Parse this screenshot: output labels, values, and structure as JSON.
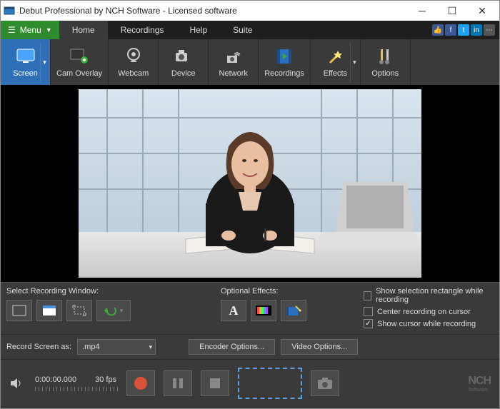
{
  "title": "Debut Professional by NCH Software - Licensed software",
  "menu_btn": "Menu",
  "tabs": [
    "Home",
    "Recordings",
    "Help",
    "Suite"
  ],
  "active_tab": 0,
  "tools": [
    {
      "label": "Screen",
      "icon": "screen",
      "dropdown": true,
      "selected": true
    },
    {
      "label": "Cam Overlay",
      "icon": "camoverlay"
    },
    {
      "label": "Webcam",
      "icon": "webcam"
    },
    {
      "label": "Device",
      "icon": "device"
    },
    {
      "label": "Network",
      "icon": "network"
    },
    {
      "label": "Recordings",
      "icon": "recordings"
    },
    {
      "label": "Effects",
      "icon": "effects",
      "dropdown": true
    },
    {
      "label": "Options",
      "icon": "options"
    }
  ],
  "select_window_label": "Select Recording Window:",
  "optional_effects_label": "Optional Effects:",
  "checks": [
    {
      "label": "Show selection rectangle while recording",
      "checked": false
    },
    {
      "label": "Center recording on cursor",
      "checked": false
    },
    {
      "label": "Show cursor while recording",
      "checked": true
    }
  ],
  "record_as_label": "Record Screen as:",
  "format": ".mp4",
  "encoder_btn": "Encoder Options...",
  "video_btn": "Video Options...",
  "timecode": "0:00:00.000",
  "fps": "30 fps",
  "logo": "NCH"
}
